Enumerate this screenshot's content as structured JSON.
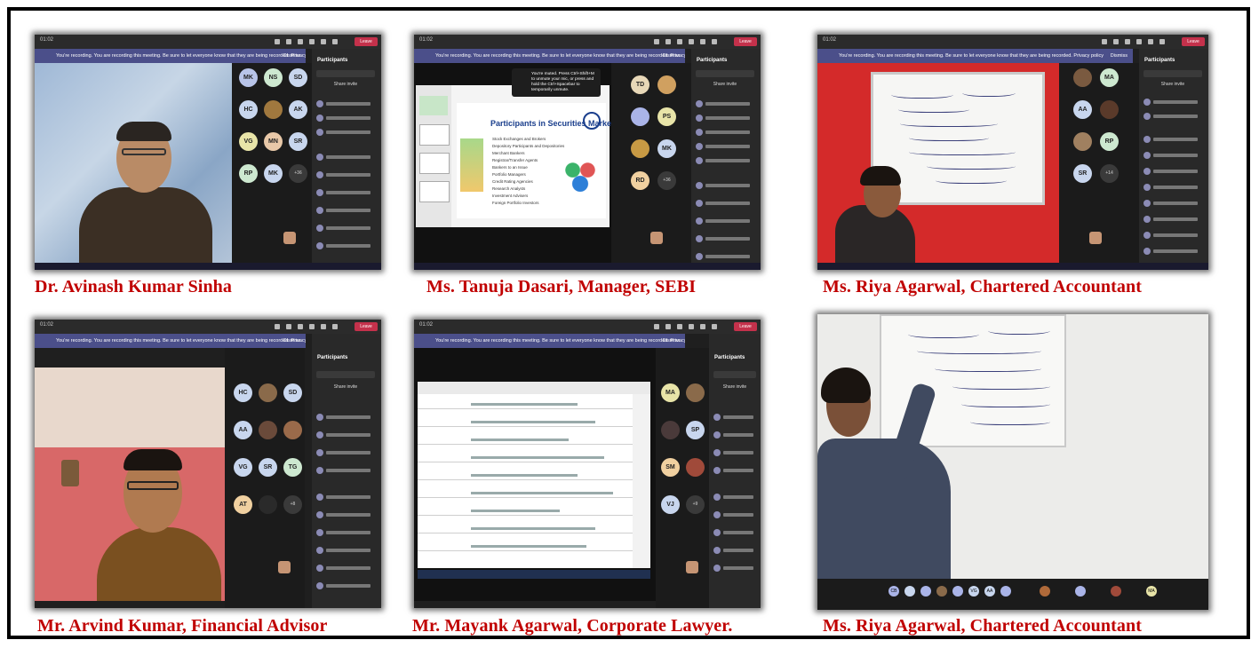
{
  "captions": [
    "Dr. Avinash Kumar Sinha",
    "Ms. Tanuja Dasari, Manager, SEBI",
    "Ms. Riya Agarwal, Chartered Accountant",
    "Mr. Arvind Kumar, Financial Advisor",
    "Mr. Mayank Agarwal, Corporate Lawyer.",
    "Ms. Riya Agarwal, Chartered Accountant"
  ],
  "meeting": {
    "leave_label": "Leave",
    "panel_title": "Participants",
    "share_label": "Share invite",
    "dismiss_label": "Dismiss",
    "notice_text": "You're recording. You are recording this meeting. Be sure to let everyone know that they are being recorded. Privacy policy",
    "time_label": "01:02"
  },
  "tiles": {
    "t1": {
      "avatars": [
        "MK",
        "NS",
        "SD",
        "HC",
        "",
        "AK",
        "VG",
        "MN",
        "SR",
        "RP",
        "MK",
        "+36"
      ]
    },
    "t2": {
      "avatars": [
        "TD",
        "",
        "",
        "PS",
        "",
        "MK",
        "RD",
        "+36"
      ],
      "slide_title": "Participants in Securities Market",
      "bullets": [
        "Stock Exchanges and Brokers",
        "Depository Participants and Depositories",
        "Merchant Bankers",
        "Registrar/Transfer Agents",
        "Bankers to an Issue",
        "Portfolio Managers",
        "Credit Rating Agencies",
        "Research Analysts",
        "Investment Advisers",
        "Foreign Portfolio Investors"
      ],
      "toast": "You're muted. Press Ctrl+Shift+M to unmute your mic, or press and hold the Ctrl+Spacebar to temporarily unmute."
    },
    "t3": {
      "avatars": [
        "",
        "MA",
        "AA",
        "",
        "",
        "RP",
        "SR",
        "+14"
      ]
    },
    "t4": {
      "avatars": [
        "HC",
        "",
        "SD",
        "AA",
        "",
        "",
        "VG",
        "SR",
        "TG",
        "AT",
        "",
        "+8"
      ]
    },
    "t5": {
      "avatars": [
        "MA",
        "",
        "",
        "SP",
        "SM",
        "",
        "VJ",
        "+9"
      ]
    },
    "t6": {
      "bottom_avatars": [
        "CB",
        "",
        "",
        "",
        "",
        "VG",
        "AA",
        "",
        "",
        "",
        "",
        "MA"
      ]
    }
  },
  "colors": {
    "caption": "#c00000",
    "teams_bg": "#1f1f1f",
    "leave": "#c4314b",
    "notice": "#4b4f8a"
  }
}
